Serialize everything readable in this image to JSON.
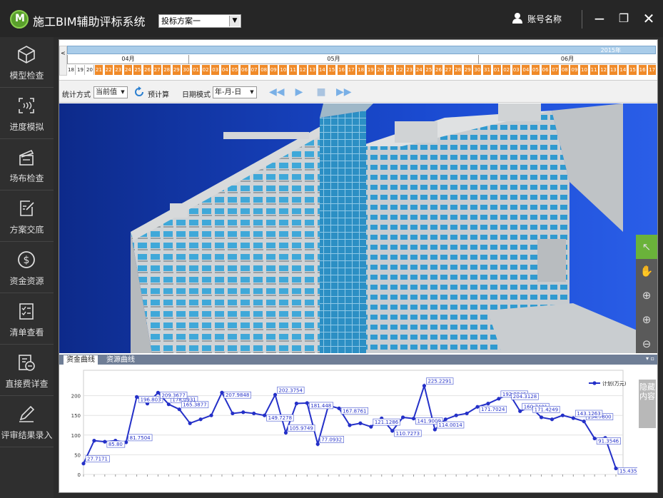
{
  "titlebar": {
    "app_title": "施工BIM辅助评标系统",
    "plan_select_value": "投标方案一",
    "user_name": "账号名称"
  },
  "sidebar": {
    "items": [
      {
        "label": "模型检查",
        "icon": "cube-icon"
      },
      {
        "label": "进度模拟",
        "icon": "progress-sim-icon"
      },
      {
        "label": "场布检查",
        "icon": "clapper-icon"
      },
      {
        "label": "方案交底",
        "icon": "edit-doc-icon"
      },
      {
        "label": "资金资源",
        "icon": "dollar-icon"
      },
      {
        "label": "清单查看",
        "icon": "checklist-icon"
      },
      {
        "label": "直接费详查",
        "icon": "cost-detail-icon"
      },
      {
        "label": "评审结果录入",
        "icon": "pencil-icon"
      }
    ]
  },
  "timeline": {
    "year": "2015年",
    "nav_left": "<",
    "months": [
      "04月",
      "05月",
      "06月"
    ],
    "days_pre": [
      "18",
      "19",
      "20"
    ],
    "days": [
      "21",
      "22",
      "23",
      "24",
      "25",
      "26",
      "27",
      "28",
      "29",
      "30",
      "01",
      "02",
      "03",
      "04",
      "05",
      "06",
      "07",
      "08",
      "09",
      "10",
      "11",
      "12",
      "13",
      "14",
      "15",
      "16",
      "17",
      "18",
      "19",
      "20",
      "21",
      "22",
      "23",
      "24",
      "25",
      "26",
      "27",
      "28",
      "29",
      "30",
      "31",
      "01",
      "02",
      "03",
      "04",
      "05",
      "06",
      "07",
      "08",
      "09",
      "10",
      "11",
      "12",
      "13",
      "14",
      "15",
      "16",
      "17"
    ]
  },
  "toolbar": {
    "stat_label": "统计方式",
    "stat_value": "当前值",
    "precalc_label": "预计算",
    "date_mode_label": "日期模式",
    "date_mode_value": "年-月-日"
  },
  "chart_panel": {
    "tabs": [
      "资金曲线",
      "资源曲线"
    ],
    "hide_tab": "隐藏内容",
    "pin_controls": "▾ ▫"
  },
  "colors": {
    "accent_green": "#6ab23a",
    "timeline_orange": "#f08a28",
    "series_blue": "#2430c8"
  },
  "chart_data": {
    "type": "line",
    "series": [
      {
        "name": "计划(万元)",
        "values": [
          27.7171,
          85.8,
          83.1,
          85.8,
          81.75,
          196.8,
          180,
          207.8,
          178.09,
          165.38,
          130,
          140,
          150,
          207.98,
          155,
          158,
          155,
          150,
          202.38,
          105.97,
          180.3,
          181.4,
          77.09,
          175,
          167.88,
          125,
          130,
          121.13,
          142.5,
          110.72,
          145,
          141.9,
          225.23,
          114.0,
          140,
          150,
          155,
          171.7,
          180,
          192.33,
          204.31,
          160.74,
          171.4,
          145,
          140,
          150,
          143.1,
          134.78,
          91.35,
          93,
          15.43
        ]
      }
    ],
    "point_labels": [
      {
        "i": 0,
        "text": "27.7171"
      },
      {
        "i": 2,
        "text": "85.80"
      },
      {
        "i": 4,
        "text": "81.7504"
      },
      {
        "i": 5,
        "text": "196.803"
      },
      {
        "i": 8,
        "text": "178.0931"
      },
      {
        "i": 7,
        "text": "209.3677"
      },
      {
        "i": 9,
        "text": "165.3877"
      },
      {
        "i": 13,
        "text": "207.9848"
      },
      {
        "i": 18,
        "text": "202.3754"
      },
      {
        "i": 17,
        "text": "149.7278"
      },
      {
        "i": 19,
        "text": "105.9749"
      },
      {
        "i": 21,
        "text": "181.448"
      },
      {
        "i": 22,
        "text": "77.0932"
      },
      {
        "i": 24,
        "text": "167.8761"
      },
      {
        "i": 27,
        "text": "121.1286"
      },
      {
        "i": 29,
        "text": "110.7273"
      },
      {
        "i": 32,
        "text": "225.2291"
      },
      {
        "i": 31,
        "text": "141.9009"
      },
      {
        "i": 33,
        "text": "114.0014"
      },
      {
        "i": 37,
        "text": "171.7024"
      },
      {
        "i": 39,
        "text": "192.3349"
      },
      {
        "i": 40,
        "text": "204.3128"
      },
      {
        "i": 41,
        "text": "160.7401"
      },
      {
        "i": 42,
        "text": "171.4249"
      },
      {
        "i": 47,
        "text": "134.7800"
      },
      {
        "i": 48,
        "text": "91.3546"
      },
      {
        "i": 46,
        "text": "143.1263"
      },
      {
        "i": 50,
        "text": "15.4352"
      }
    ],
    "ylim": [
      0,
      250
    ],
    "yticks": [
      0,
      50,
      100,
      150,
      200
    ],
    "xlabel": "",
    "ylabel": "",
    "legend": "top-right",
    "grid": true
  }
}
